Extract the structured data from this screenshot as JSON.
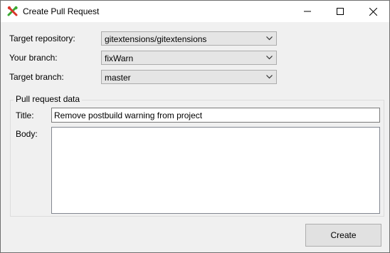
{
  "window": {
    "title": "Create Pull Request",
    "app_icon": "gitextensions-icon",
    "controls": {
      "minimize": "minimize-icon",
      "maximize": "maximize-icon",
      "close": "close-icon"
    }
  },
  "form": {
    "target_repository": {
      "label": "Target repository:",
      "value": "gitextensions/gitextensions"
    },
    "your_branch": {
      "label": "Your branch:",
      "value": "fixWarn"
    },
    "target_branch": {
      "label": "Target branch:",
      "value": "master"
    }
  },
  "pull_request": {
    "group_title": "Pull request data",
    "title_label": "Title:",
    "title_value": "Remove postbuild warning from project",
    "body_label": "Body:",
    "body_value": ""
  },
  "actions": {
    "create_label": "Create"
  },
  "colors": {
    "accent_red": "#d9342b",
    "accent_green": "#3aa832"
  }
}
